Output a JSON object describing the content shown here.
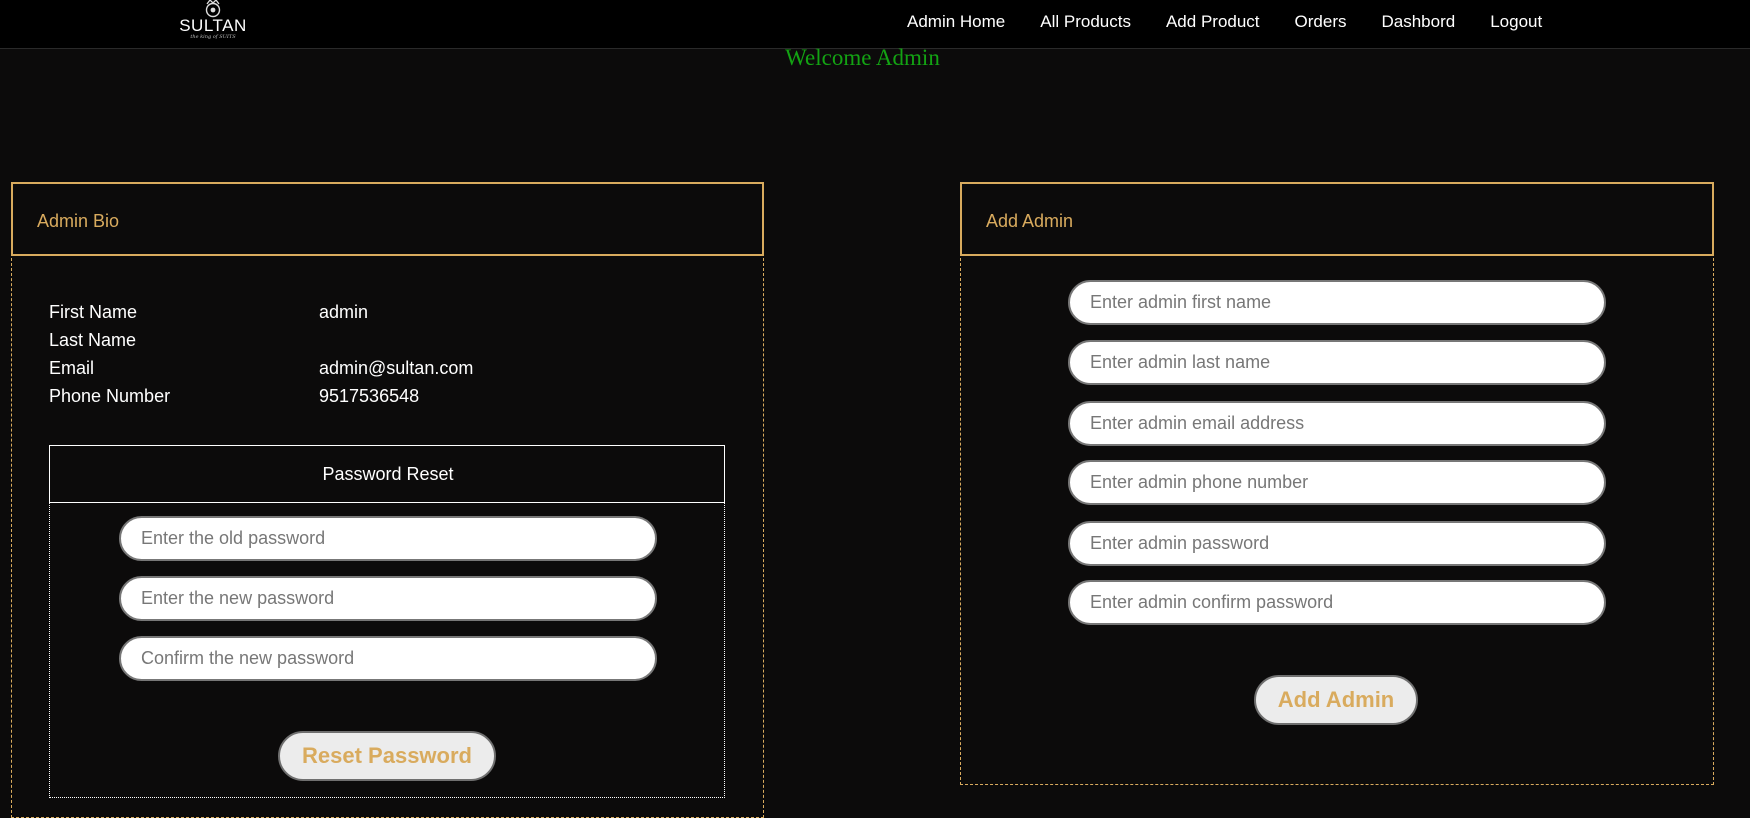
{
  "brand": {
    "name": "SULTAN",
    "tagline": "the king of SUITS"
  },
  "nav": {
    "links": [
      "Admin Home",
      "All Products",
      "Add Product",
      "Orders",
      "Dashbord",
      "Logout"
    ]
  },
  "welcome": "Welcome Admin",
  "bio": {
    "title": "Admin Bio",
    "rows": [
      {
        "label": "First Name",
        "value": "admin"
      },
      {
        "label": "Last Name",
        "value": ""
      },
      {
        "label": "Email",
        "value": "admin@sultan.com"
      },
      {
        "label": "Phone Number",
        "value": "9517536548"
      }
    ]
  },
  "reset": {
    "title": "Password Reset",
    "fields": [
      {
        "placeholder": "Enter the old password"
      },
      {
        "placeholder": "Enter the new password"
      },
      {
        "placeholder": "Confirm the new password"
      }
    ],
    "button": "Reset Password"
  },
  "add_admin": {
    "title": "Add Admin",
    "fields": [
      {
        "placeholder": "Enter admin first name"
      },
      {
        "placeholder": "Enter admin last name"
      },
      {
        "placeholder": "Enter admin email address"
      },
      {
        "placeholder": "Enter admin phone number"
      },
      {
        "placeholder": "Enter admin password"
      },
      {
        "placeholder": "Enter admin confirm password"
      }
    ],
    "button": "Add Admin"
  },
  "colors": {
    "accent": "#d9ab5e",
    "welcome": "#13a313",
    "background": "#0c0b0b"
  }
}
